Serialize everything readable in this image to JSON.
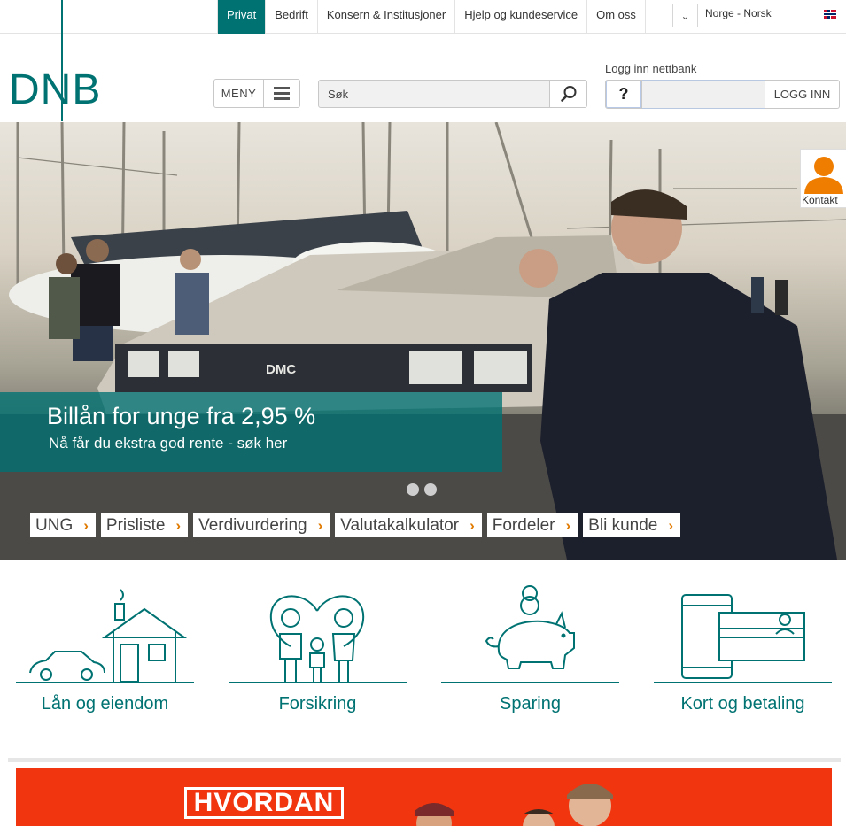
{
  "topnav": {
    "items": [
      {
        "label": "Privat",
        "active": true
      },
      {
        "label": "Bedrift"
      },
      {
        "label": "Konsern & Institusjoner"
      },
      {
        "label": "Hjelp og kundeservice"
      },
      {
        "label": "Om oss"
      }
    ]
  },
  "language": {
    "selected": "Norge - Norsk"
  },
  "logo": {
    "text": "DNB"
  },
  "header": {
    "menu_label": "MENY",
    "search_placeholder": "Søk",
    "login_label": "Logg inn nettbank",
    "help_label": "?",
    "login_button": "LOGG INN"
  },
  "hero": {
    "headline": "Billån for unge fra 2,95 %",
    "subline": "Nå får du ekstra god rente - søk her",
    "contact_label": "Kontakt",
    "quicklinks": [
      "UNG",
      "Prisliste",
      "Verdivurdering",
      "Valutakalkulator",
      "Fordeler",
      "Bli kunde"
    ]
  },
  "categories": [
    {
      "label": "Lån og eiendom",
      "icon": "house-car-icon"
    },
    {
      "label": "Forsikring",
      "icon": "family-heart-icon"
    },
    {
      "label": "Sparing",
      "icon": "piggy-bank-icon"
    },
    {
      "label": "Kort og betaling",
      "icon": "phone-card-icon"
    }
  ],
  "promo": {
    "headline": "HVORDAN"
  },
  "colors": {
    "brand": "#007272",
    "accent": "#e07a00",
    "promo": "#f0350f"
  }
}
